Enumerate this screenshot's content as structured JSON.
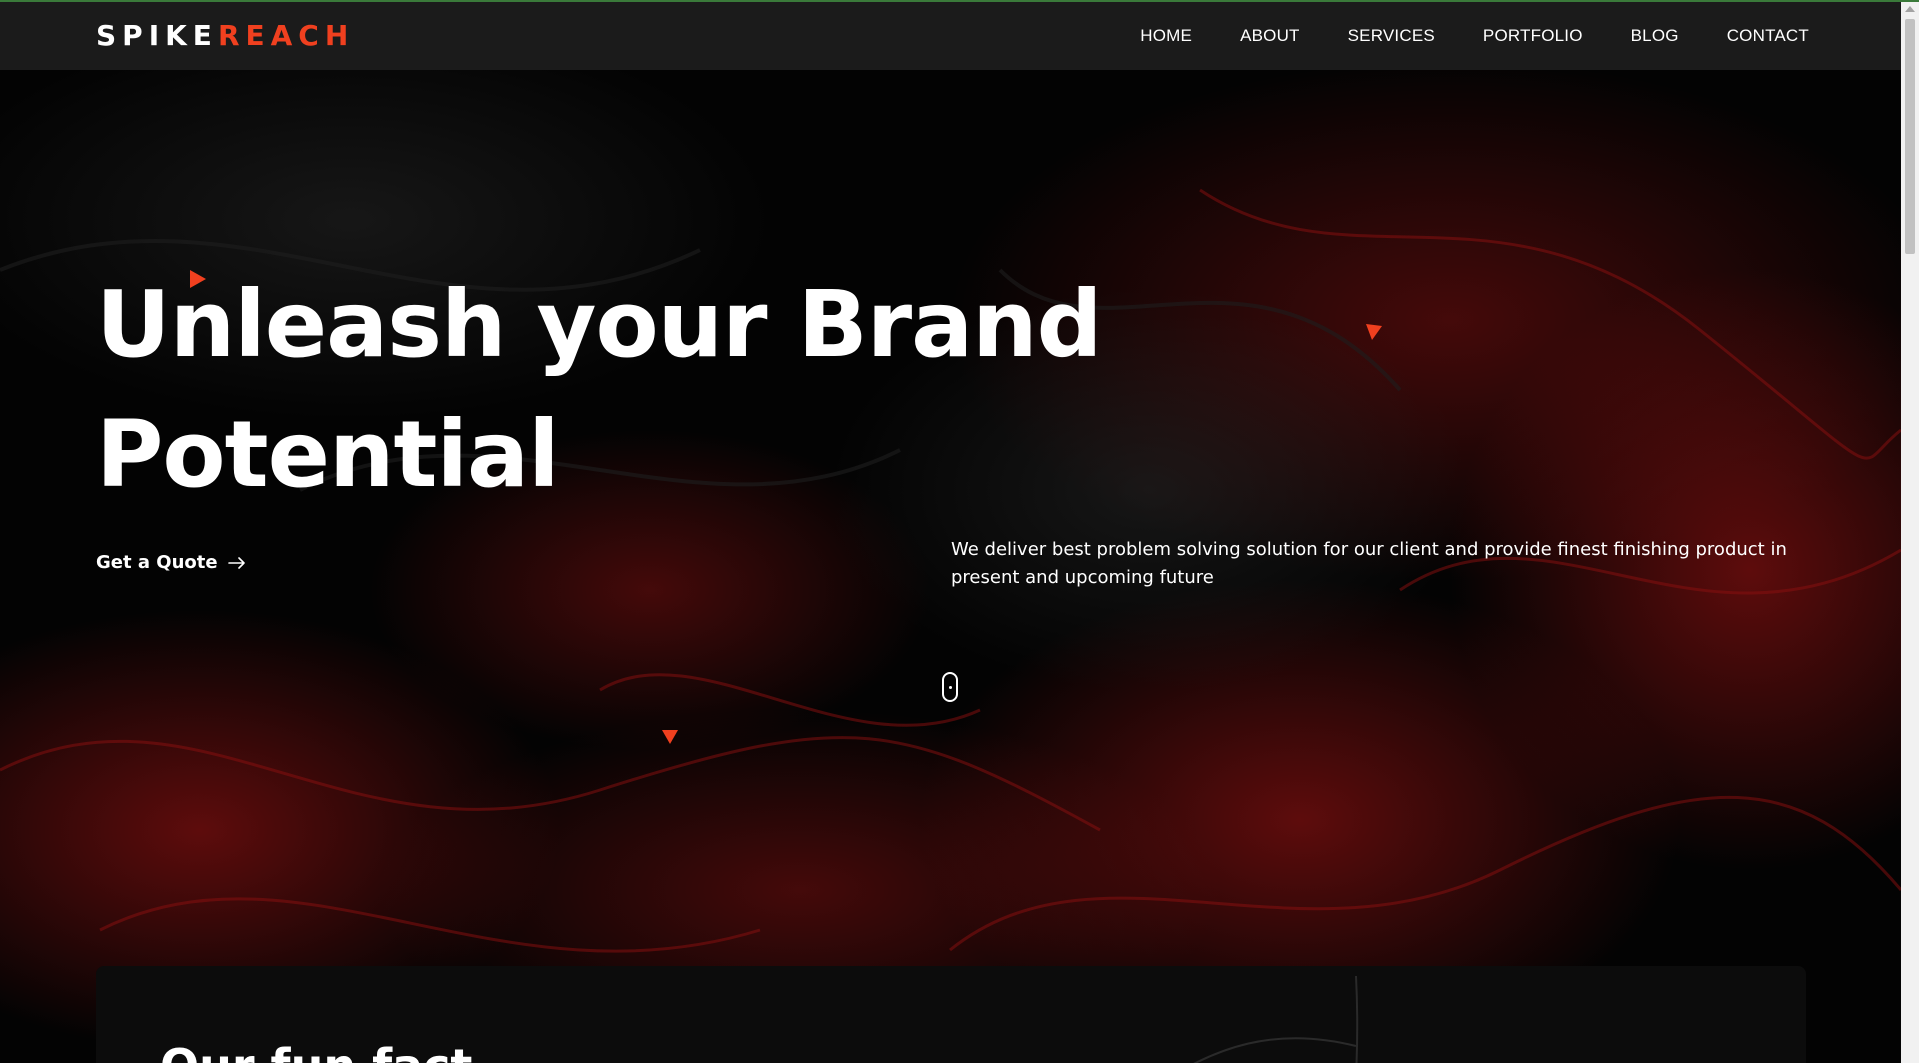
{
  "header": {
    "logo_part1": "SPIKE",
    "logo_part2": "REACH",
    "nav": [
      "HOME",
      "ABOUT",
      "SERVICES",
      "PORTFOLIO",
      "BLOG",
      "CONTACT"
    ]
  },
  "hero": {
    "title_line1": "Unleash your Brand",
    "title_line2": "Potential",
    "cta_label": "Get a Quote",
    "description": "We deliver best problem solving solution for our client and provide finest finishing product in present and upcoming future"
  },
  "fun_fact": {
    "title": "Our fun fact"
  },
  "colors": {
    "accent": "#f0401f",
    "header_bg": "#1b1b1b",
    "hero_bg": "#030303",
    "text": "#ffffff"
  },
  "icons": {
    "cta_arrow": "arrow-right-icon",
    "scroll_indicator": "mouse-scroll-icon",
    "decor": "triangle-icon"
  }
}
